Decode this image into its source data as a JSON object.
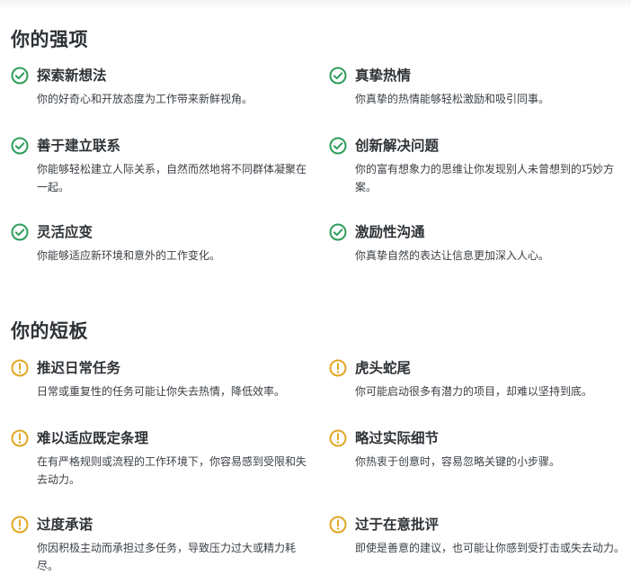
{
  "strengths": {
    "title": "你的强项",
    "items": [
      {
        "title": "探索新想法",
        "desc": "你的好奇心和开放态度为工作带来新鲜视角。"
      },
      {
        "title": "真挚热情",
        "desc": "你真挚的热情能够轻松激励和吸引同事。"
      },
      {
        "title": "善于建立联系",
        "desc": "你能够轻松建立人际关系，自然而然地将不同群体凝聚在一起。"
      },
      {
        "title": "创新解决问题",
        "desc": "你的富有想象力的思维让你发现别人未曾想到的巧妙方案。"
      },
      {
        "title": "灵活应变",
        "desc": "你能够适应新环境和意外的工作变化。"
      },
      {
        "title": "激励性沟通",
        "desc": "你真挚自然的表达让信息更加深入人心。"
      }
    ]
  },
  "weaknesses": {
    "title": "你的短板",
    "items": [
      {
        "title": "推迟日常任务",
        "desc": "日常或重复性的任务可能让你失去热情，降低效率。"
      },
      {
        "title": "虎头蛇尾",
        "desc": "你可能启动很多有潜力的项目，却难以坚持到底。"
      },
      {
        "title": "难以适应既定条理",
        "desc": "在有严格规则或流程的工作环境下，你容易感到受限和失去动力。"
      },
      {
        "title": "略过实际细节",
        "desc": "你热衷于创意时，容易忽略关键的小步骤。"
      },
      {
        "title": "过度承诺",
        "desc": "你因积极主动而承担过多任务，导致压力过大或精力耗尽。"
      },
      {
        "title": "过于在意批评",
        "desc": "即使是善意的建议，也可能让你感到受打击或失去动力。"
      }
    ]
  },
  "colors": {
    "strength_icon": "#2e9d5b",
    "weakness_icon": "#e0a722"
  },
  "icons": {
    "strength": "check-circle-icon",
    "weakness": "warning-circle-icon"
  }
}
